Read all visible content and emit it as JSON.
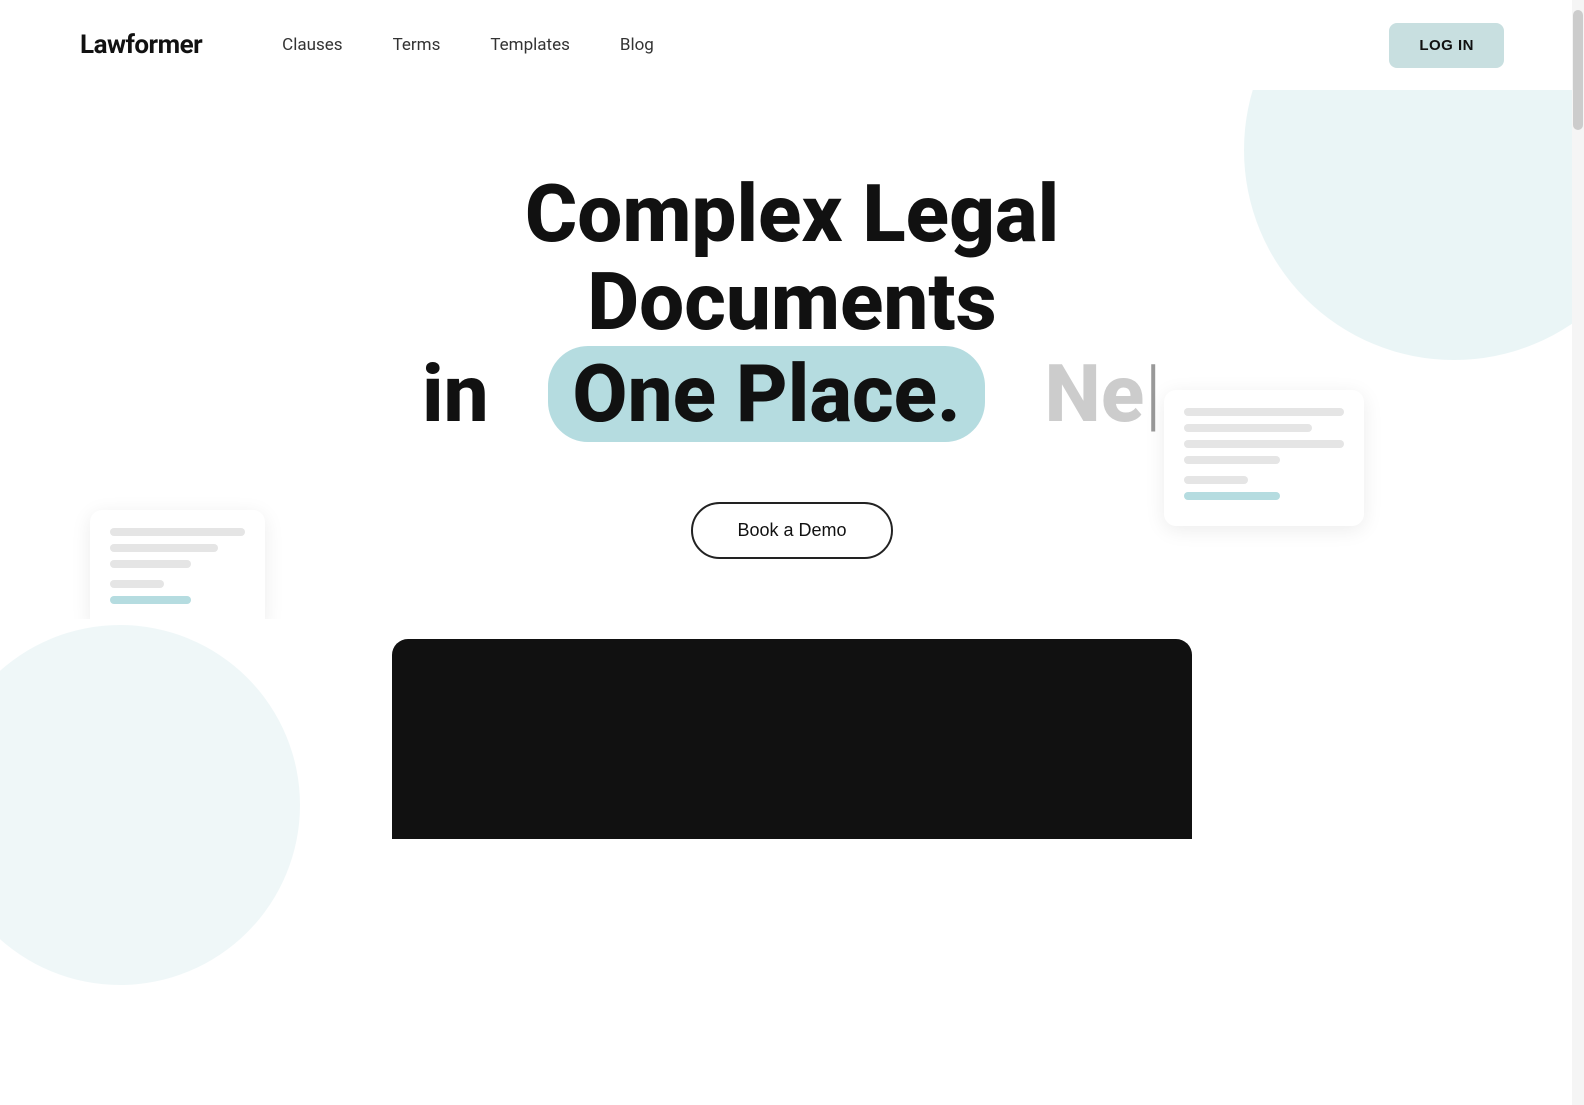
{
  "nav": {
    "logo": "Lawformer",
    "links": [
      {
        "label": "Clauses",
        "href": "#"
      },
      {
        "label": "Terms",
        "href": "#"
      },
      {
        "label": "Templates",
        "href": "#"
      },
      {
        "label": "Blog",
        "href": "#"
      }
    ],
    "login_label": "LOG IN"
  },
  "hero": {
    "line1": "Complex Legal Documents",
    "line2_prefix": "in",
    "line2_highlight": "One Place.",
    "line2_typing": "Ne",
    "cursor": "|",
    "cta_label": "Book a Demo"
  },
  "doc_card_left": {
    "lines": [
      "full",
      "medium",
      "short",
      "tiny",
      "accent-short"
    ]
  },
  "doc_card_right": {
    "lines": [
      "full",
      "medium",
      "full",
      "short",
      "tiny",
      "tiny2"
    ]
  },
  "colors": {
    "accent_teal": "#b5dce0",
    "bg_circle": "#d6ecee",
    "login_bg": "#c8dfe0",
    "text_dark": "#111111",
    "text_muted": "#cccccc"
  }
}
